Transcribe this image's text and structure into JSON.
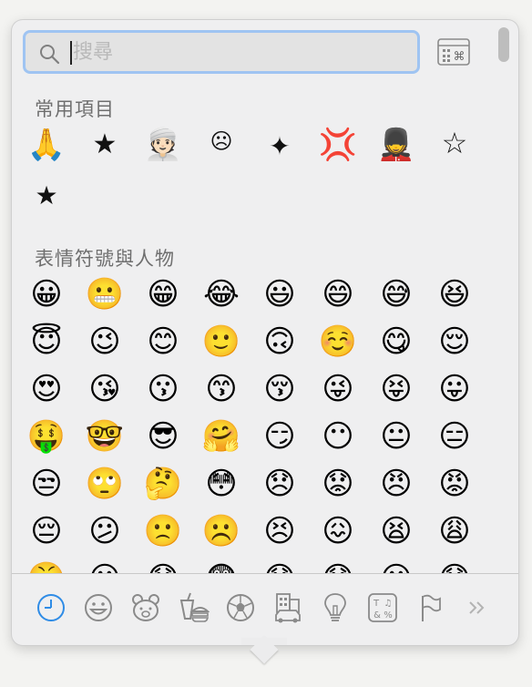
{
  "search": {
    "placeholder": "搜尋",
    "value": ""
  },
  "sections": {
    "frequent": {
      "title": "常用項目",
      "items": [
        "🙏",
        "★",
        "👳🏻",
        "☹",
        "✦",
        "💢",
        "💂",
        "☆",
        "★"
      ]
    },
    "smileys": {
      "title": "表情符號與人物",
      "rows": [
        [
          "😀",
          "😬",
          "😁",
          "😂",
          "😃",
          "😄",
          "😅",
          "😆"
        ],
        [
          "😇",
          "😉",
          "😊",
          "🙂",
          "🙃",
          "☺️",
          "😋",
          "😌"
        ],
        [
          "😍",
          "😘",
          "😗",
          "😙",
          "😚",
          "😜",
          "😝",
          "😛"
        ],
        [
          "🤑",
          "🤓",
          "😎",
          "🤗",
          "😏",
          "😶",
          "😐",
          "😑"
        ],
        [
          "😒",
          "🙄",
          "🤔",
          "😳",
          "😞",
          "😟",
          "😠",
          "😡"
        ],
        [
          "😔",
          "😕",
          "🙁",
          "☹️",
          "😣",
          "😖",
          "😫",
          "😩"
        ],
        [
          "😤",
          "😮",
          "😱",
          "😨",
          "😰",
          "😯",
          "😦",
          "😧"
        ]
      ]
    }
  },
  "categories": [
    {
      "name": "recent",
      "icon": "clock-icon",
      "active": true
    },
    {
      "name": "smileys",
      "icon": "smiley-icon"
    },
    {
      "name": "animals",
      "icon": "bear-icon"
    },
    {
      "name": "food",
      "icon": "food-icon"
    },
    {
      "name": "activity",
      "icon": "soccer-ball-icon"
    },
    {
      "name": "travel",
      "icon": "building-car-icon"
    },
    {
      "name": "objects",
      "icon": "lightbulb-icon"
    },
    {
      "name": "symbols",
      "icon": "symbols-icon"
    },
    {
      "name": "flags",
      "icon": "flag-icon"
    },
    {
      "name": "more",
      "icon": "chevron-double-right-icon"
    }
  ],
  "colors": {
    "accent": "#2f8ce6",
    "icon_gray": "#8a8a8a"
  }
}
